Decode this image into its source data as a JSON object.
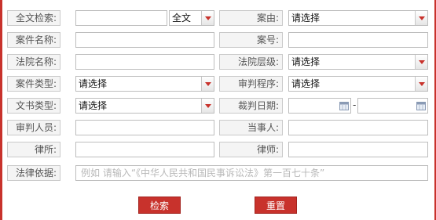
{
  "form": {
    "fulltext": {
      "label": "全文检索:",
      "scope_value": "全文"
    },
    "case_reason": {
      "label": "案由:",
      "value": "请选择"
    },
    "case_name": {
      "label": "案件名称:"
    },
    "case_number": {
      "label": "案号:"
    },
    "court_name": {
      "label": "法院名称:"
    },
    "court_level": {
      "label": "法院层级:",
      "value": "请选择"
    },
    "case_type": {
      "label": "案件类型:",
      "value": "请选择"
    },
    "trial_procedure": {
      "label": "审判程序:",
      "value": "请选择"
    },
    "document_type": {
      "label": "文书类型:",
      "value": "请选择"
    },
    "judgment_date": {
      "label": "裁判日期:",
      "separator": "-"
    },
    "judge": {
      "label": "审判人员:"
    },
    "party": {
      "label": "当事人:"
    },
    "law_firm": {
      "label": "律所:"
    },
    "lawyer": {
      "label": "律师:"
    },
    "legal_basis": {
      "label": "法律依据:",
      "placeholder": "例如 请输入“《中华人民共和国民事诉讼法》第一百七十条”"
    }
  },
  "buttons": {
    "search": "检索",
    "reset": "重置"
  },
  "colors": {
    "accent": "#c8322c",
    "label_bg": "#f4f4f4",
    "border": "#bdbdbd"
  },
  "icons": {
    "dropdown": "chevron-down-icon",
    "calendar": "calendar-icon"
  }
}
